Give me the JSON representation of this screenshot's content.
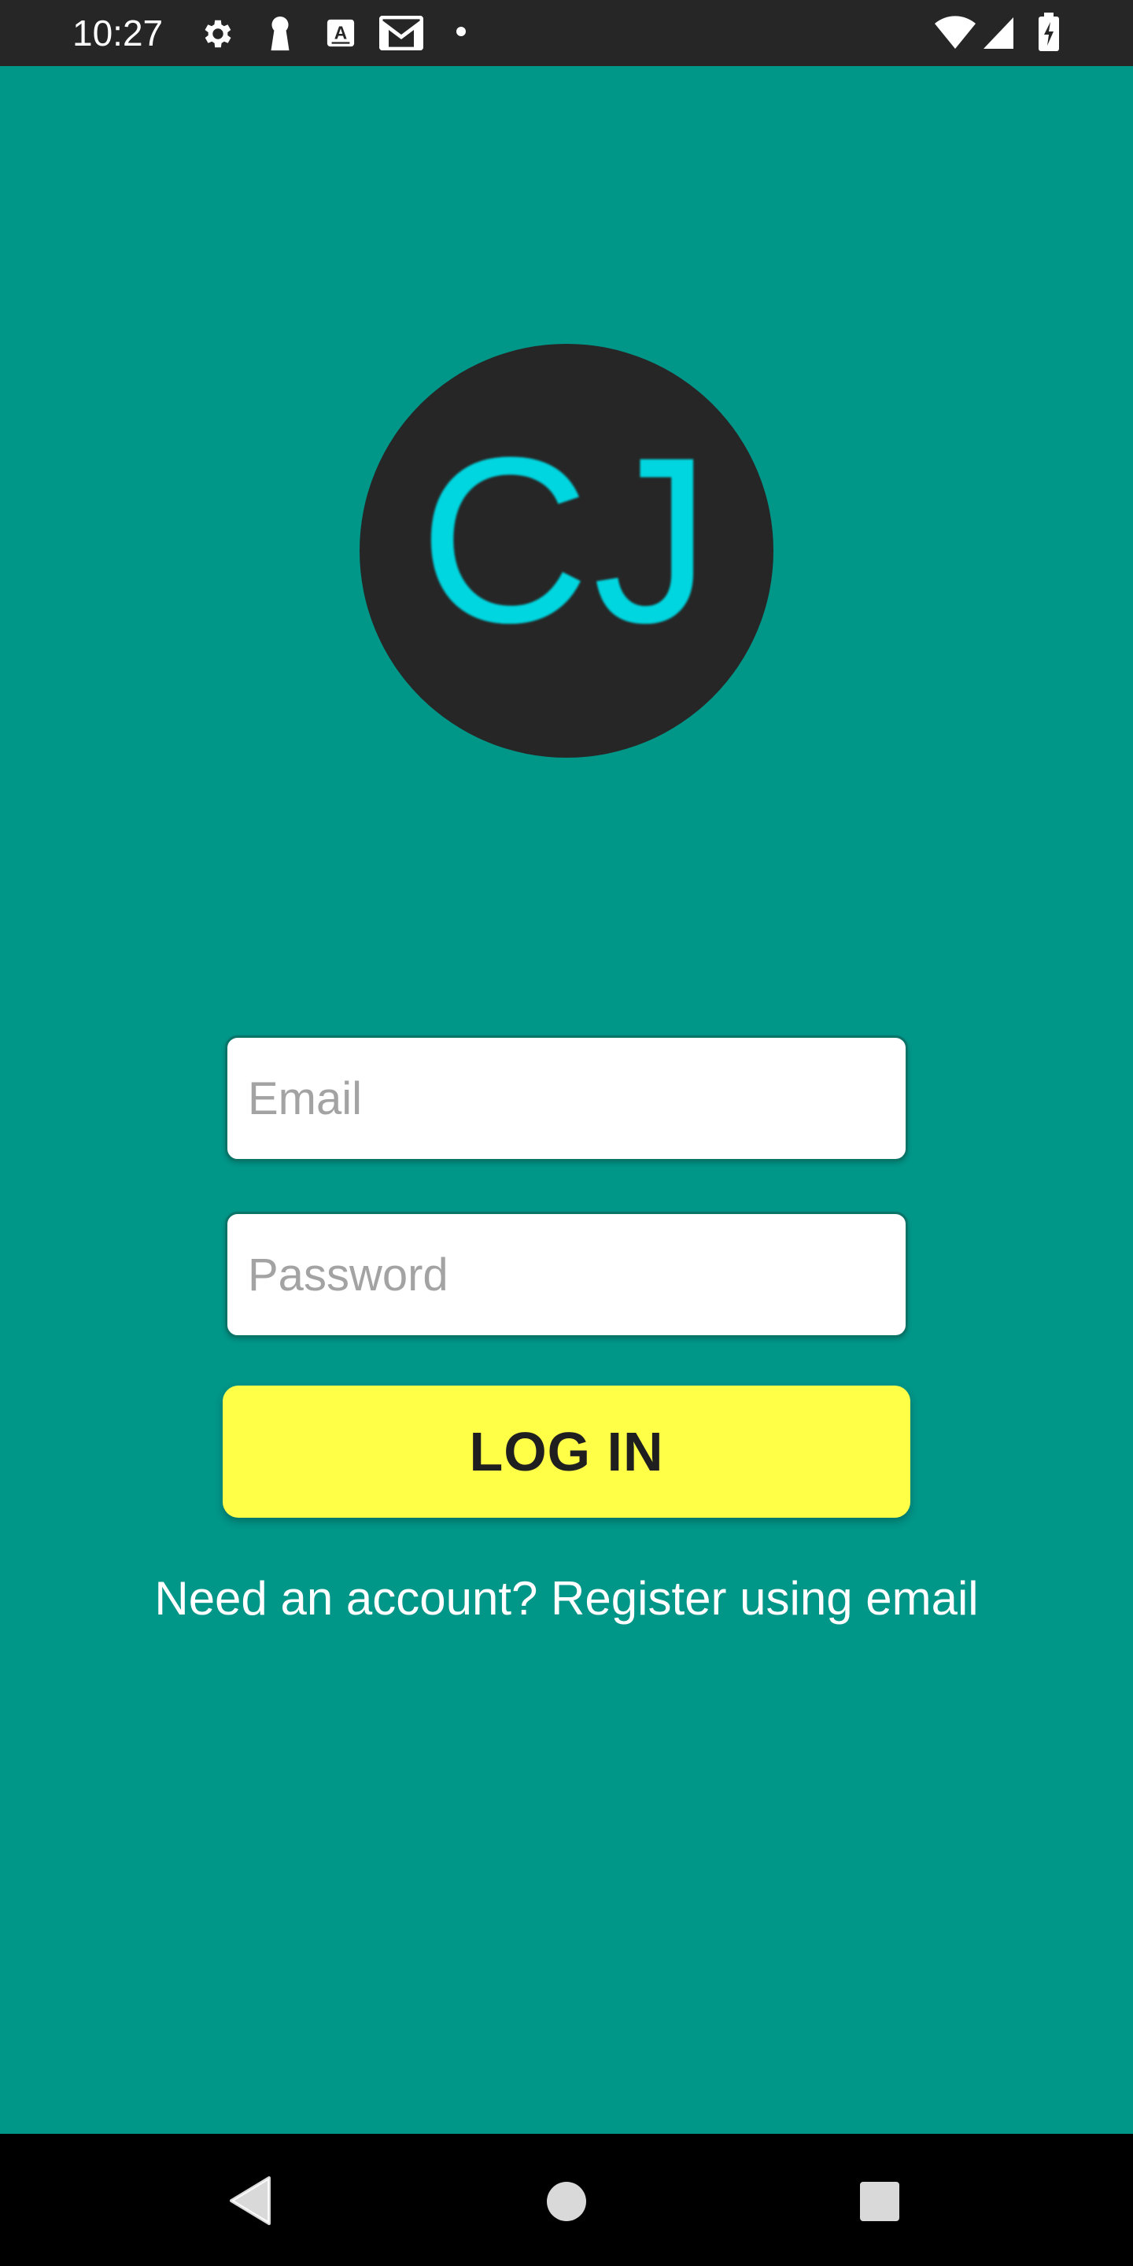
{
  "status_bar": {
    "time": "10:27",
    "left_icons": [
      "settings-icon",
      "keyhole-icon",
      "keyboard-a-icon",
      "gmail-icon",
      "dot-icon"
    ],
    "right_icons": [
      "wifi-icon",
      "cell-signal-icon",
      "battery-charging-icon"
    ]
  },
  "logo": {
    "text": "CJ",
    "circle_color": "#262626",
    "text_color": "#00d6e0"
  },
  "form": {
    "email": {
      "value": "",
      "placeholder": "Email"
    },
    "password": {
      "value": "",
      "placeholder": "Password"
    },
    "login_label": "LOG IN",
    "register_text": "Need an account? Register using email"
  },
  "colors": {
    "background": "#009688",
    "button": "#ffff47",
    "status_bar": "#262626",
    "nav_bar": "#000000"
  },
  "nav_bar": {
    "buttons": [
      "back-icon",
      "home-icon",
      "recents-icon"
    ]
  }
}
